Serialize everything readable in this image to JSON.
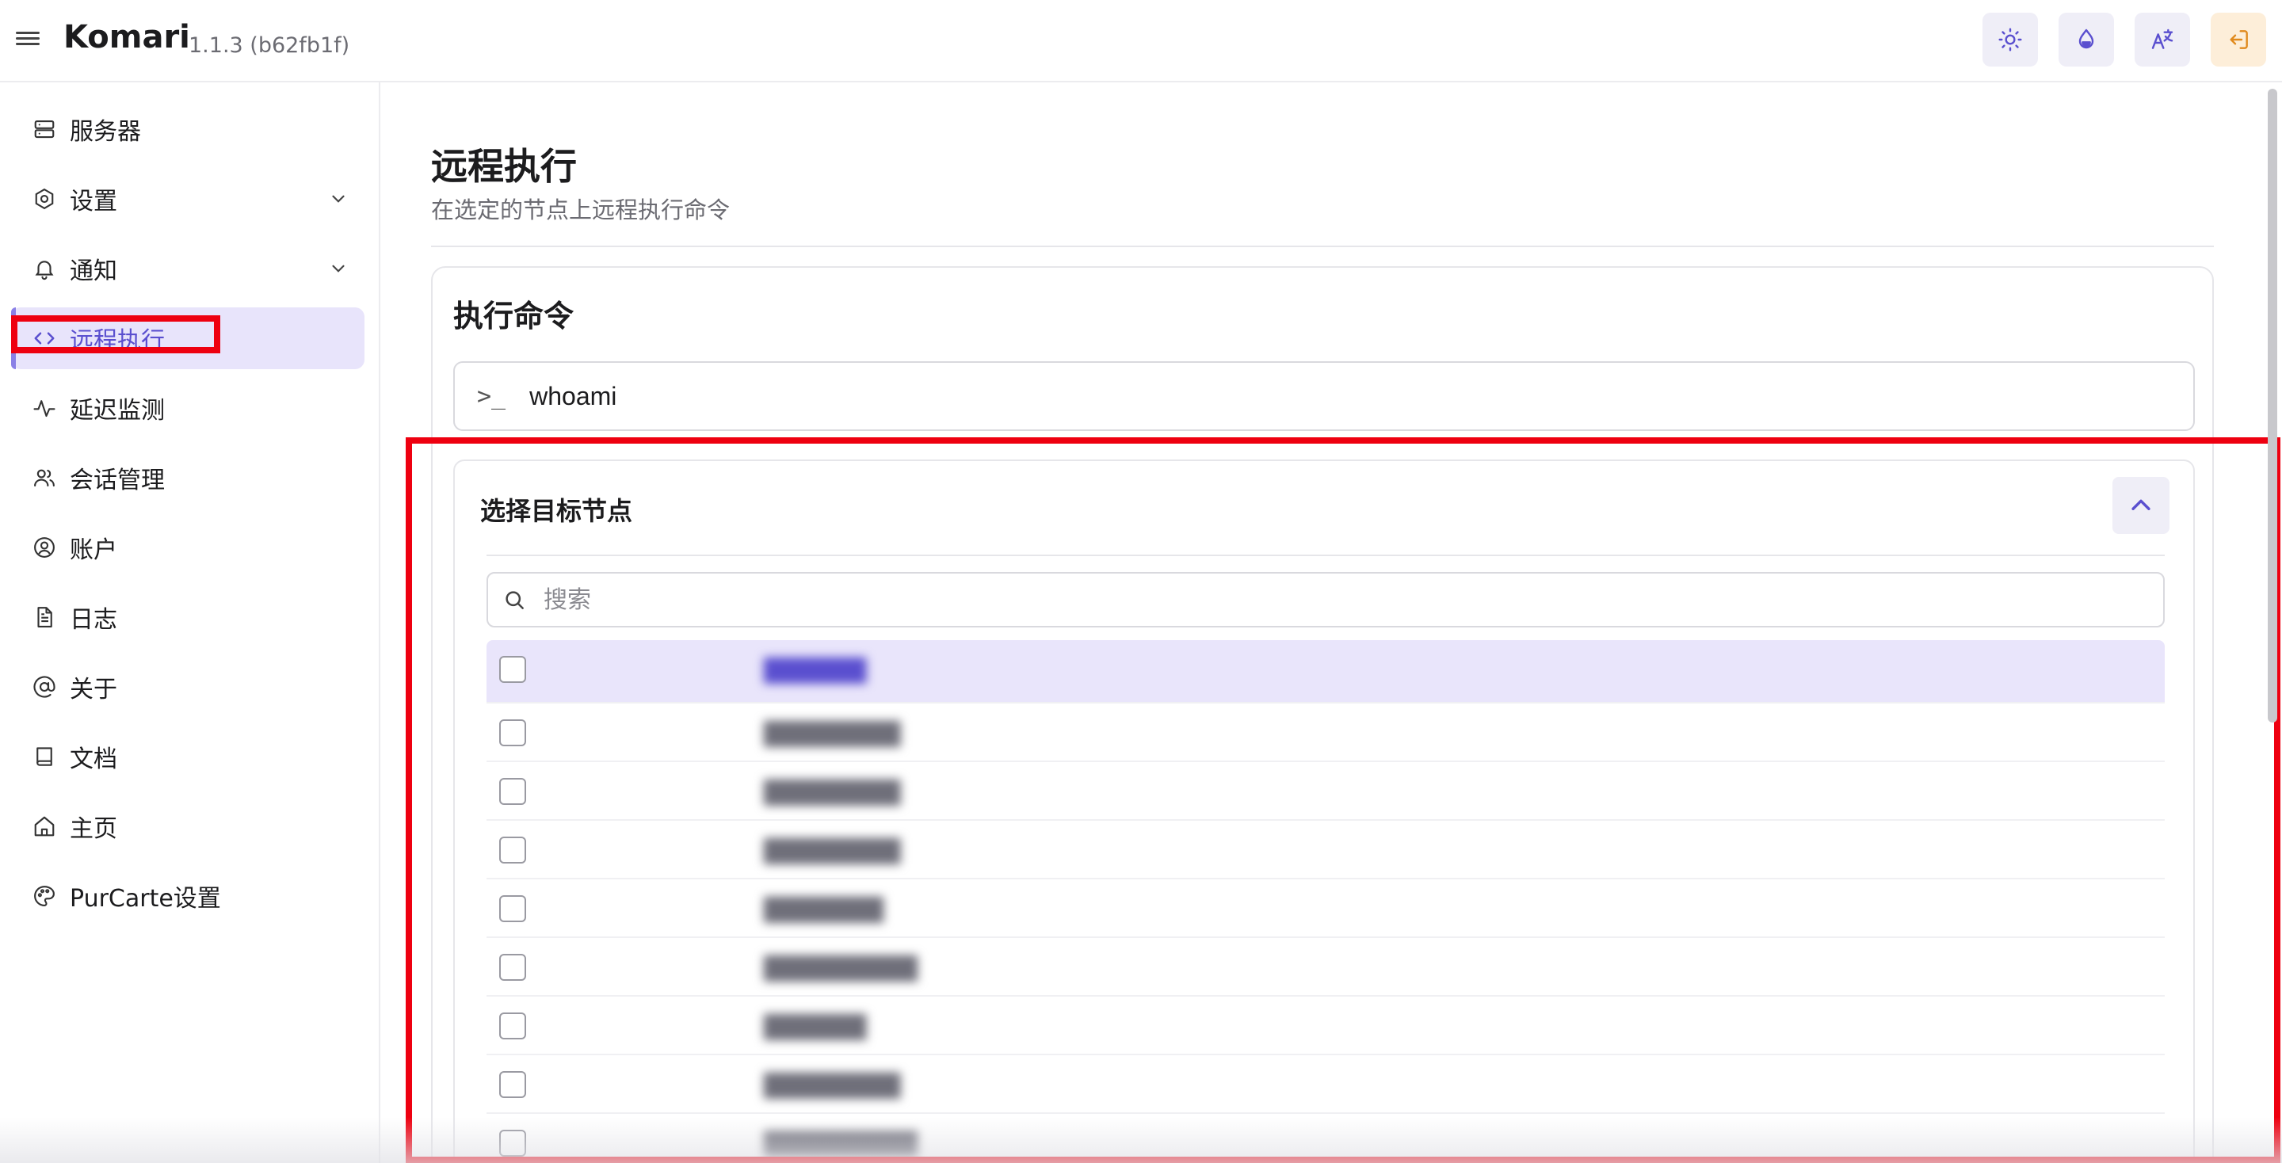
{
  "header": {
    "title": "Komari",
    "version": "1.1.3 (b62fb1f)",
    "actions": [
      "sun-icon",
      "droplet-icon",
      "translate-icon",
      "logout-icon"
    ]
  },
  "sidebar": {
    "items": [
      {
        "label": "服务器",
        "icon": "server-icon"
      },
      {
        "label": "设置",
        "icon": "settings-icon",
        "expandable": true
      },
      {
        "label": "通知",
        "icon": "bell-icon",
        "expandable": true
      },
      {
        "label": "远程执行",
        "icon": "code-icon",
        "active": true
      },
      {
        "label": "延迟监测",
        "icon": "activity-icon"
      },
      {
        "label": "会话管理",
        "icon": "users-icon"
      },
      {
        "label": "账户",
        "icon": "user-circle-icon"
      },
      {
        "label": "日志",
        "icon": "file-text-icon"
      },
      {
        "label": "关于",
        "icon": "at-sign-icon"
      },
      {
        "label": "文档",
        "icon": "book-icon"
      },
      {
        "label": "主页",
        "icon": "home-icon"
      },
      {
        "label": "PurCarte设置",
        "icon": "palette-icon"
      }
    ]
  },
  "main": {
    "title": "远程执行",
    "subtitle": "在选定的节点上远程执行命令",
    "card_title": "执行命令",
    "command_value": "whoami",
    "prompt_symbol": ">_",
    "target": {
      "title": "选择目标节点",
      "search_placeholder": "搜索",
      "nodes": [
        "██████",
        "████████",
        "████████",
        "████████",
        "███████",
        "█████████",
        "██████",
        "████████",
        "█████████"
      ]
    }
  },
  "colors": {
    "accent": "#5a4fcf",
    "active_bg": "#e8e4fb",
    "highlight": "#ee0010"
  }
}
